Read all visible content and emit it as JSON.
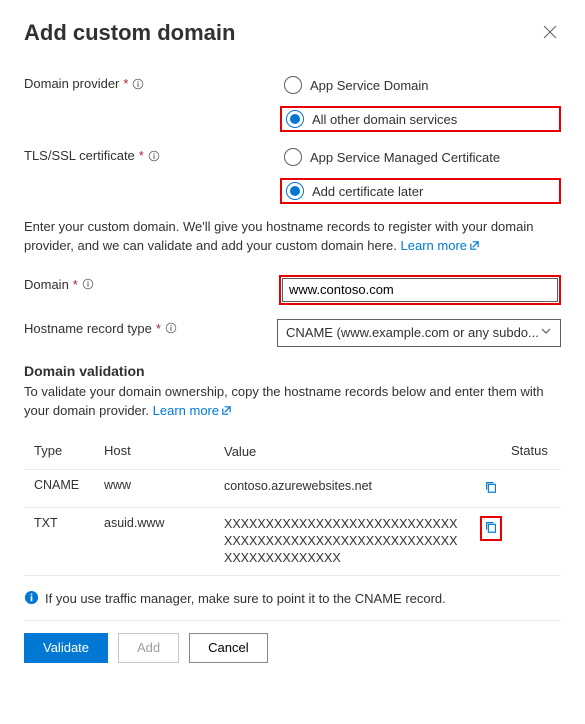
{
  "title": "Add custom domain",
  "fields": {
    "domain_provider": {
      "label": "Domain provider"
    },
    "tls": {
      "label": "TLS/SSL certificate"
    },
    "domain": {
      "label": "Domain"
    },
    "hostname_type": {
      "label": "Hostname record type"
    }
  },
  "options": {
    "provider_app_service": "App Service Domain",
    "provider_other": "All other domain services",
    "tls_managed": "App Service Managed Certificate",
    "tls_later": "Add certificate later"
  },
  "description": {
    "text": "Enter your custom domain. We'll give you hostname records to register with your domain provider, and we can validate and add your custom domain here.",
    "learn_more": "Learn more"
  },
  "domain_value": "www.contoso.com",
  "hostname_select": "CNAME (www.example.com or any subdo...",
  "validation": {
    "heading": "Domain validation",
    "text": "To validate your domain ownership, copy the hostname records below and enter them with your domain provider.",
    "learn_more": "Learn more"
  },
  "table": {
    "headers": {
      "type": "Type",
      "host": "Host",
      "value": "Value",
      "status": "Status"
    },
    "rows": [
      {
        "type": "CNAME",
        "host": "www",
        "value": "contoso.azurewebsites.net"
      },
      {
        "type": "TXT",
        "host": "asuid.www",
        "value": "XXXXXXXXXXXXXXXXXXXXXXXXXXXXXXXXXXXXXXXXXXXXXXXXXXXXXXXXXXXXXXXXXXXXXX"
      }
    ]
  },
  "info_note": "If you use traffic manager, make sure to point it to the CNAME record.",
  "buttons": {
    "validate": "Validate",
    "add": "Add",
    "cancel": "Cancel"
  }
}
